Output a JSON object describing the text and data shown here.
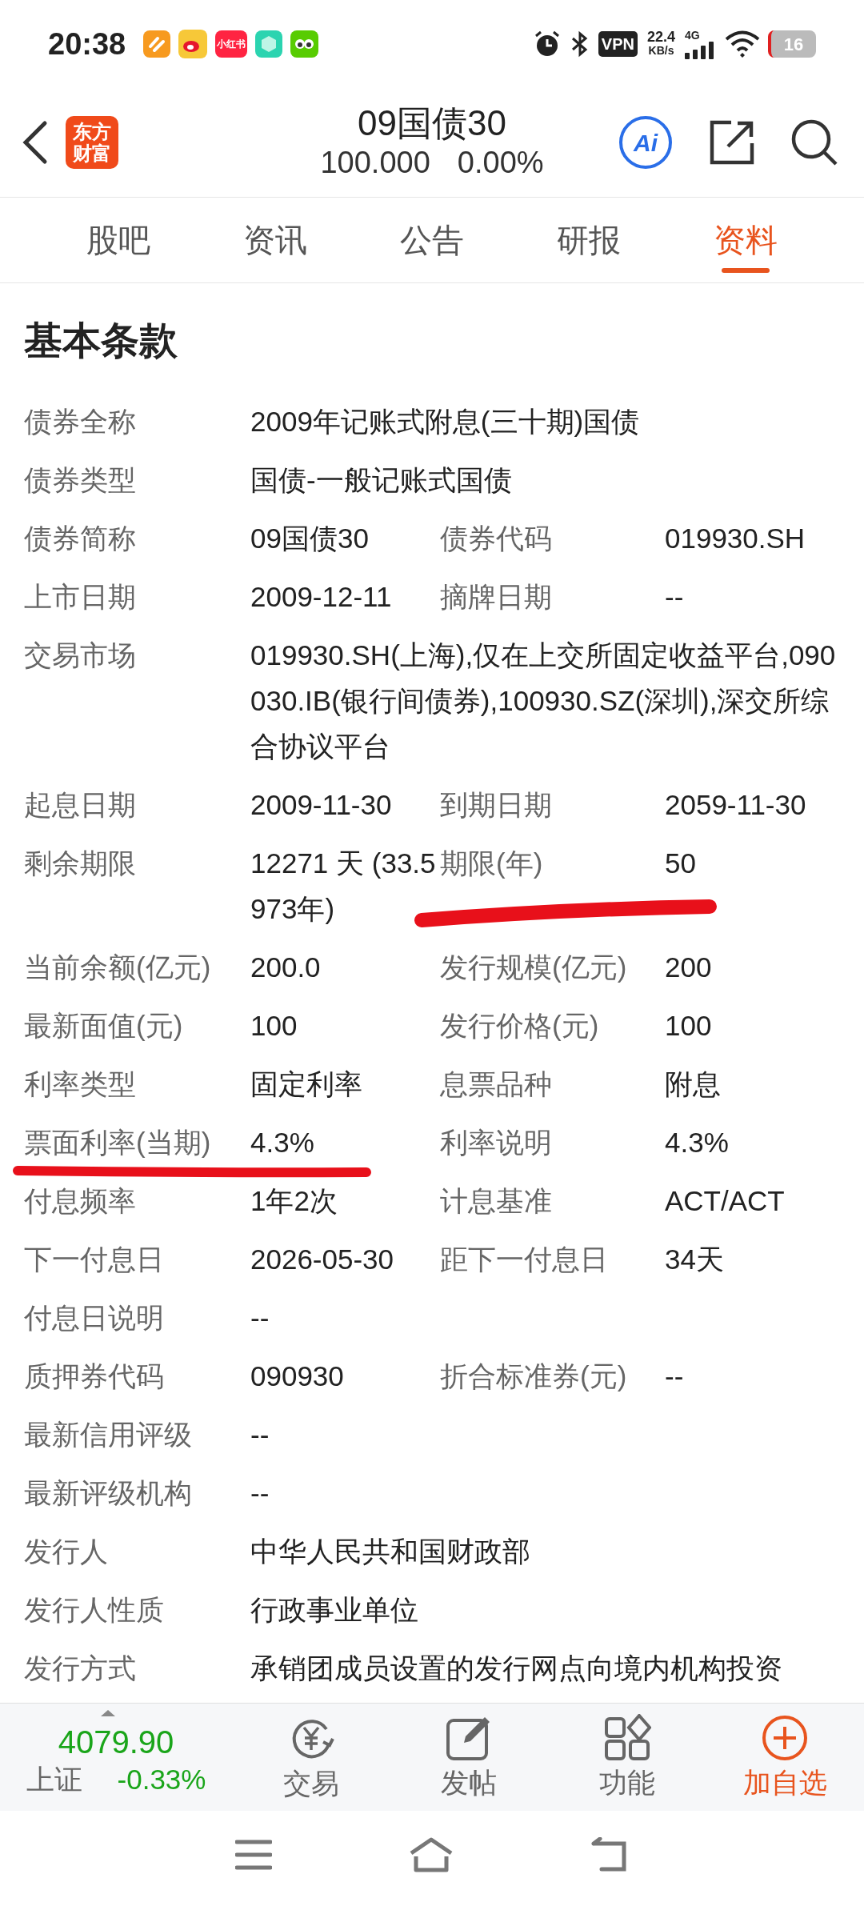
{
  "status_bar": {
    "time": "20:38",
    "app_badge": "小红书",
    "vpn": "VPN",
    "speed": "22.4",
    "speed_unit": "KB/s",
    "network": "4G",
    "battery": "16"
  },
  "header": {
    "logo_lines": [
      "东方",
      "财富"
    ],
    "title": "09国债30",
    "price": "100.000",
    "change": "0.00%",
    "ai_label": "Ai"
  },
  "tabs": [
    {
      "label": "股吧",
      "selected": false
    },
    {
      "label": "资讯",
      "selected": false
    },
    {
      "label": "公告",
      "selected": false
    },
    {
      "label": "研报",
      "selected": false
    },
    {
      "label": "资料",
      "selected": true
    }
  ],
  "section_title": "基本条款",
  "rows": [
    {
      "label": "债券全称",
      "value": "2009年记账式附息(三十期)国债"
    },
    {
      "label": "债券类型",
      "value": "国债-一般记账式国债"
    },
    {
      "label": "债券简称",
      "value": "09国债30",
      "label_2": "债券代码",
      "value_2": "019930.SH"
    },
    {
      "label": "上市日期",
      "value": "2009-12-11",
      "label_2": "摘牌日期",
      "value_2": "--"
    },
    {
      "label": "交易市场",
      "value": "019930.SH(上海),仅在上交所固定收益平台,090030.IB(银行间债券),100930.SZ(深圳),深交所综合协议平台"
    },
    {
      "label": "起息日期",
      "value": "2009-11-30",
      "label_2": "到期日期",
      "value_2": "2059-11-30"
    },
    {
      "label": "剩余期限",
      "value": "12271 天 (33.5973年)",
      "label_2": "期限(年)",
      "value_2": "50"
    },
    {
      "label": "当前余额(亿元)",
      "value": "200.0",
      "label_2": "发行规模(亿元)",
      "value_2": "200"
    },
    {
      "label": "最新面值(元)",
      "value": "100",
      "label_2": "发行价格(元)",
      "value_2": "100"
    },
    {
      "label": "利率类型",
      "value": "固定利率",
      "label_2": "息票品种",
      "value_2": "附息"
    },
    {
      "label": "票面利率(当期)",
      "value": "4.3%",
      "label_2": "利率说明",
      "value_2": "4.3%"
    },
    {
      "label": "付息频率",
      "value": "1年2次",
      "label_2": "计息基准",
      "value_2": "ACT/ACT"
    },
    {
      "label": "下一付息日",
      "value": "2026-05-30",
      "label_2": "距下一付息日",
      "value_2": "34天"
    },
    {
      "label": "付息日说明",
      "value": "--"
    },
    {
      "label": "质押券代码",
      "value": "090930",
      "label_2": "折合标准券(元)",
      "value_2": "--"
    },
    {
      "label": "最新信用评级",
      "value": "--"
    },
    {
      "label": "最新评级机构",
      "value": "--"
    },
    {
      "label": "发行人",
      "value": "中华人民共和国财政部"
    },
    {
      "label": "发行人性质",
      "value": "行政事业单位"
    },
    {
      "label": "发行方式",
      "value": "承销团成员设置的发行网点向境内机构投资"
    }
  ],
  "bottom_bar": {
    "index_value": "4079.90",
    "index_name": "上证",
    "index_change": "-0.33%",
    "actions": [
      {
        "kind": "trade",
        "label": "交易",
        "accent": false
      },
      {
        "kind": "post",
        "label": "发帖",
        "accent": false
      },
      {
        "kind": "functions",
        "label": "功能",
        "accent": false
      },
      {
        "kind": "add",
        "label": "加自选",
        "accent": true
      }
    ]
  }
}
